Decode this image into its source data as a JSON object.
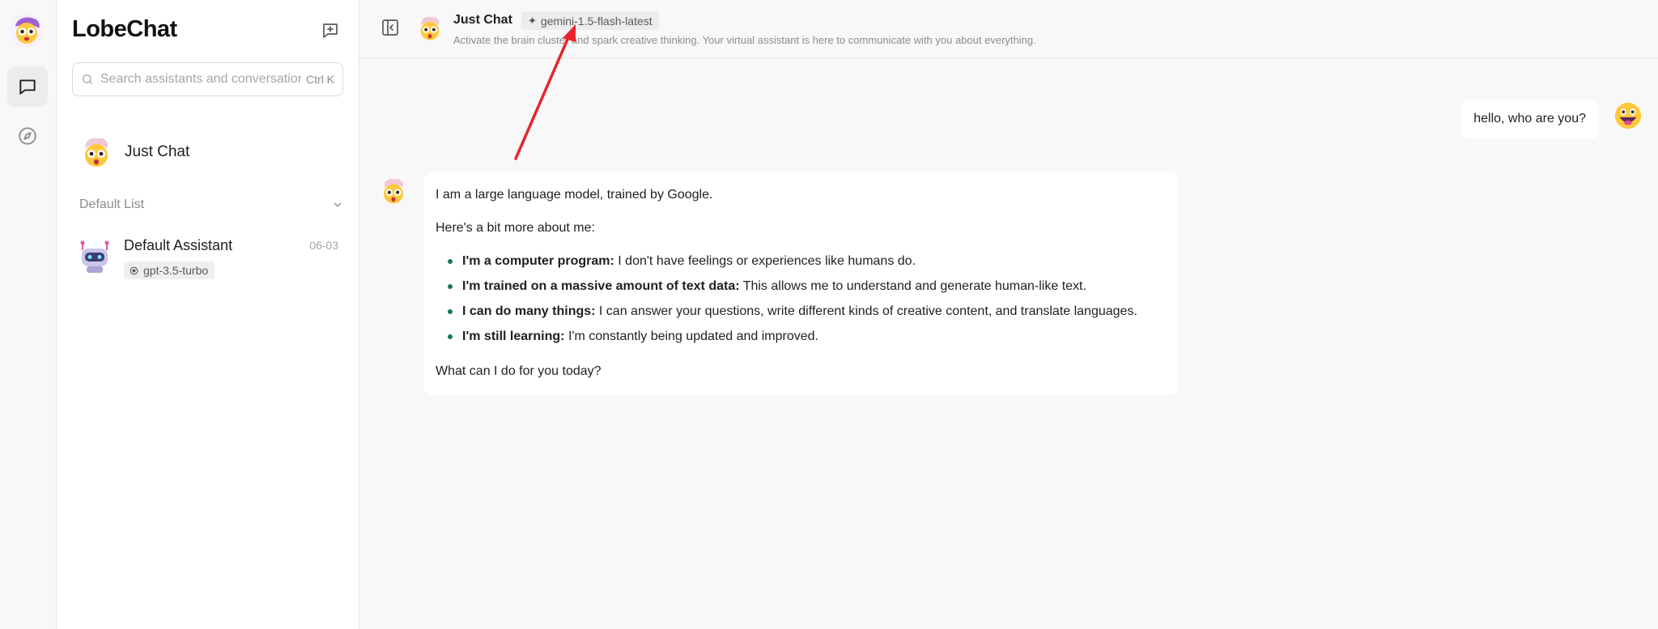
{
  "app": {
    "brand": "LobeChat"
  },
  "rail": {
    "items": [
      {
        "name": "chat-icon",
        "active": true
      },
      {
        "name": "discover-icon",
        "active": false
      }
    ]
  },
  "sidebar": {
    "search": {
      "placeholder": "Search assistants and conversations",
      "shortcut": "Ctrl K"
    },
    "inbox": {
      "label": "Just Chat"
    },
    "group": {
      "title": "Default List"
    },
    "sessions": [
      {
        "title": "Default Assistant",
        "date": "06-03",
        "model": "gpt-3.5-turbo"
      }
    ]
  },
  "chat": {
    "header": {
      "title": "Just Chat",
      "model": "gemini-1.5-flash-latest",
      "description": "Activate the brain cluster and spark creative thinking. Your virtual assistant is here to communicate with you about everything."
    },
    "messages": {
      "user": "hello, who are you?",
      "assistant": {
        "intro": "I am a large language model, trained by Google.",
        "lead": "Here's a bit more about me:",
        "bullets": [
          {
            "bold": "I'm a computer program:",
            "text": " I don't have feelings or experiences like humans do."
          },
          {
            "bold": "I'm trained on a massive amount of text data:",
            "text": " This allows me to understand and generate human-like text."
          },
          {
            "bold": "I can do many things:",
            "text": " I can answer your questions, write different kinds of creative content, and translate languages."
          },
          {
            "bold": "I'm still learning:",
            "text": " I'm constantly being updated and improved."
          }
        ],
        "closing": "What can I do for you today?"
      }
    }
  },
  "colors": {
    "annotation_arrow": "#e8242b",
    "bullet": "#1a7a4c"
  }
}
